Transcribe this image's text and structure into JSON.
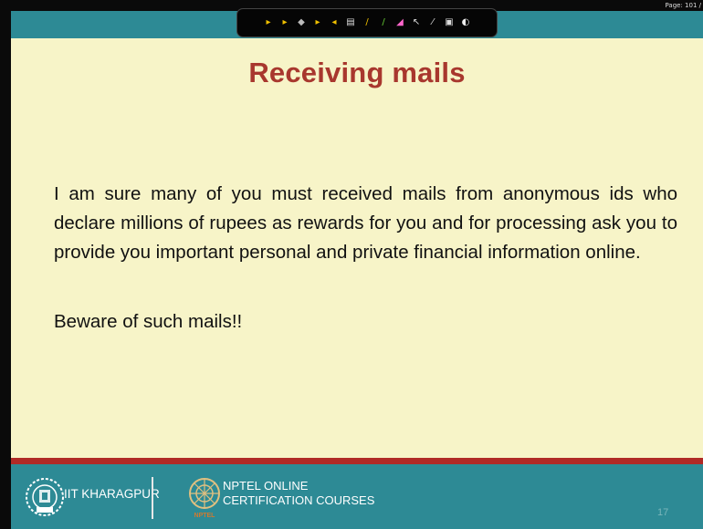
{
  "top_bar": {
    "page_indicator": "Page: 101 /"
  },
  "toolbar": {
    "tools": [
      {
        "icon": "arrow-right-icon",
        "glyph": "▸",
        "color": "#f0c000"
      },
      {
        "icon": "arrow-right-icon",
        "glyph": "▸",
        "color": "#f0c000"
      },
      {
        "icon": "select-icon",
        "glyph": "◆",
        "color": "#bbbbbb"
      },
      {
        "icon": "arrow-right-icon",
        "glyph": "▸",
        "color": "#f0c000"
      },
      {
        "icon": "arrow-left-icon",
        "glyph": "◂",
        "color": "#f0c000"
      },
      {
        "icon": "document-icon",
        "glyph": "▤",
        "color": "#dddddd"
      },
      {
        "icon": "pen-icon",
        "glyph": "/",
        "color": "#f0c000"
      },
      {
        "icon": "marker-icon",
        "glyph": "/",
        "color": "#66cc33"
      },
      {
        "icon": "highlighter-icon",
        "glyph": "◢",
        "color": "#ff66cc"
      },
      {
        "icon": "pointer-icon",
        "glyph": "↖",
        "color": "#dddddd"
      },
      {
        "icon": "line-tool-icon",
        "glyph": "⁄",
        "color": "#dddddd"
      },
      {
        "icon": "box-icon",
        "glyph": "▣",
        "color": "#dddddd"
      },
      {
        "icon": "eraser-icon",
        "glyph": "◐",
        "color": "#eeeeee"
      }
    ]
  },
  "slide": {
    "title": "Receiving  mails",
    "body": "I am sure many of you must received mails from anonymous ids who declare millions of rupees as rewards for you and for processing ask you to provide you important personal and private financial information online.",
    "beware": "Beware of such mails!!"
  },
  "footer": {
    "institute": "IIT KHARAGPUR",
    "nptel_line1": "NPTEL ONLINE",
    "nptel_line2": "CERTIFICATION COURSES",
    "nptel_logo_text": "NPTEL",
    "slide_number": "17"
  },
  "colors": {
    "title": "#a8372e",
    "slide_bg": "#f7f4c8",
    "teal": "#2d8a95",
    "red_line": "#b02a26"
  }
}
